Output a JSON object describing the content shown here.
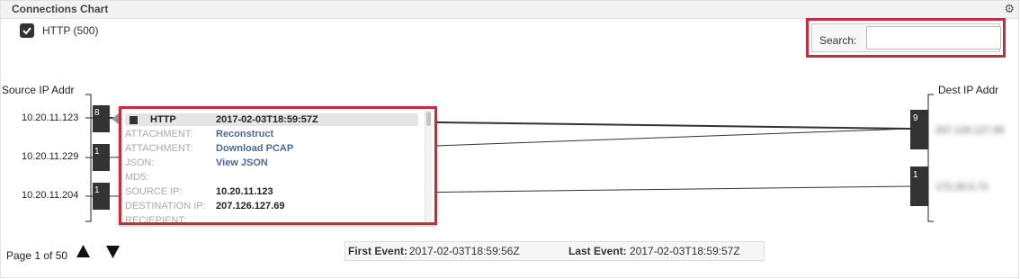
{
  "panel": {
    "title": "Connections Chart",
    "settings_icon": "gear-icon"
  },
  "legend": {
    "label": "HTTP (500)",
    "checked": true
  },
  "search": {
    "label": "Search:",
    "value": "",
    "placeholder": ""
  },
  "axes": {
    "source_title": "Source IP Addr",
    "dest_title": "Dest IP Addr"
  },
  "sources": [
    {
      "ip": "10.20.11.123",
      "count": "8"
    },
    {
      "ip": "10.20.11.229",
      "count": "1"
    },
    {
      "ip": "10.20.11.204",
      "count": "1"
    }
  ],
  "destinations": [
    {
      "ip": "207.126.127.69",
      "count": "9"
    },
    {
      "ip": "172.28.6.73",
      "count": "1"
    }
  ],
  "popup": {
    "protocol": "HTTP",
    "timestamp": "2017-02-03T18:59:57Z",
    "rows": [
      {
        "key": "ATTACHMENT:",
        "value": "Reconstruct",
        "link": true
      },
      {
        "key": "ATTACHMENT:",
        "value": "Download PCAP",
        "link": true
      },
      {
        "key": "JSON:",
        "value": "View JSON",
        "link": true
      },
      {
        "key": "MD5:",
        "value": "",
        "link": false
      },
      {
        "key": "SOURCE IP:",
        "value": "10.20.11.123",
        "link": false
      },
      {
        "key": "DESTINATION IP:",
        "value": "207.126.127.69",
        "link": false
      },
      {
        "key": "RECIEPIENT:",
        "value": "",
        "link": false
      }
    ]
  },
  "pager": {
    "text": "Page 1 of 50",
    "up_icon": "triangle-up-icon",
    "down_icon": "triangle-down-icon"
  },
  "events": {
    "first_label": "First Event:",
    "first_value": "2017-02-03T18:59:56Z",
    "last_label": "Last Event:",
    "last_value": "2017-02-03T18:59:57Z"
  },
  "colors": {
    "highlight": "#c22e3f",
    "node": "#333333",
    "link": "#4a6a96"
  }
}
